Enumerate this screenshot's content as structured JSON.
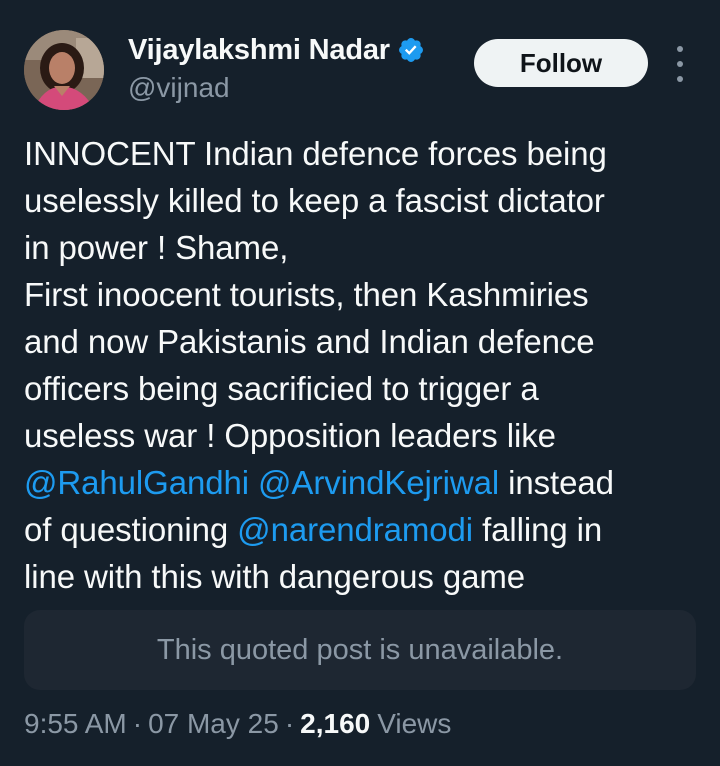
{
  "author": {
    "display_name": "Vijaylakshmi Nadar",
    "handle": "@vijnad",
    "verified": true,
    "avatar": "profile-photo"
  },
  "actions": {
    "follow_label": "Follow",
    "more_icon": "more-vertical-icon"
  },
  "tweet": {
    "lines": [
      "INNOCENT Indian defence forces being",
      "uselessly killed to keep a fascist dictator",
      "in power ! Shame,",
      "First inoocent tourists, then Kashmiries",
      "and now Pakistanis and Indian defence",
      "officers being sacrificied to trigger a",
      "useless war ! Opposition leaders like"
    ],
    "mention_line": {
      "mention1": "@RahulGandhi",
      "mention2": "@ArvindKejriwal",
      "tail": "instead"
    },
    "mention_line2": {
      "head": "of questioning",
      "mention3": "@narendramodi",
      "tail": "falling in"
    },
    "last_line": "line with this with dangerous game"
  },
  "quoted": {
    "text": "This quoted post is unavailable."
  },
  "meta": {
    "time": "9:55 AM",
    "separator": "·",
    "date": "07 May 25",
    "views_count": "2,160",
    "views_label": "Views"
  },
  "colors": {
    "background": "#15202b",
    "accent": "#1d9bf0",
    "secondary_text": "#8b98a5",
    "primary_text": "#f7f9f9"
  }
}
